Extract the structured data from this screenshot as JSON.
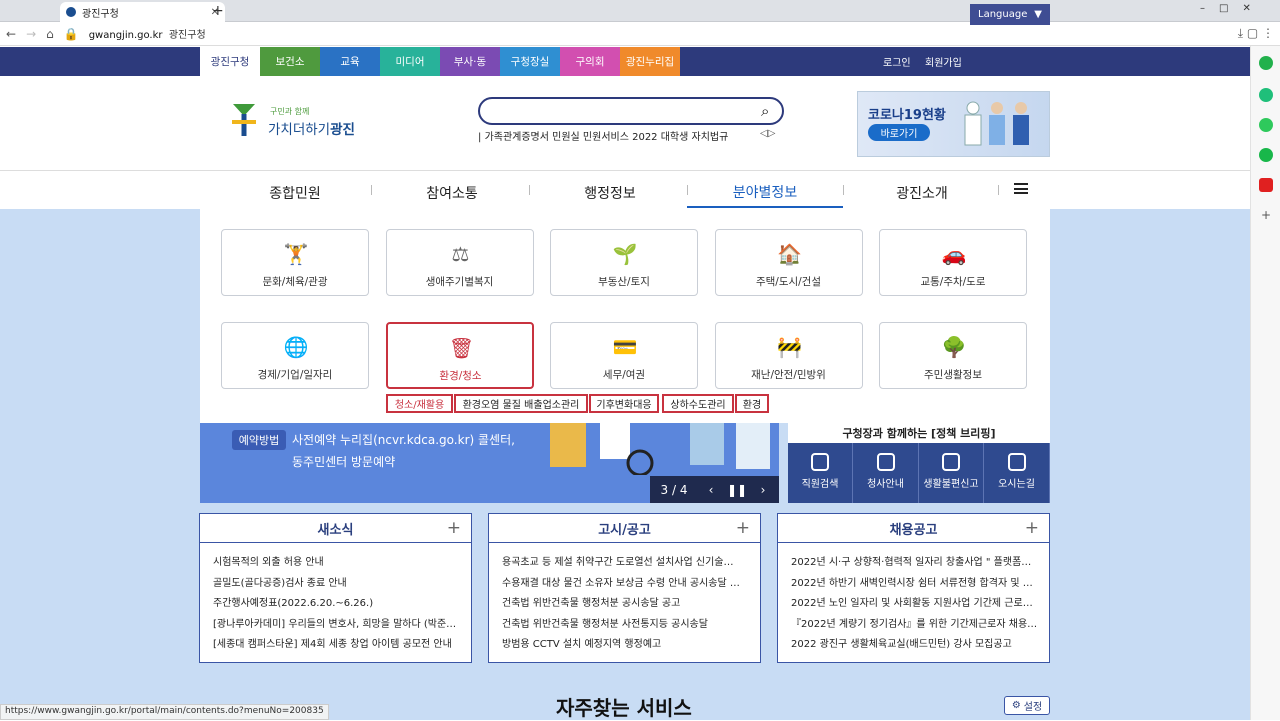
{
  "browser": {
    "tab_title": "광진구청",
    "url_domain": "gwangjin.go.kr",
    "url_title": "광진구청"
  },
  "topbar": {
    "nav": [
      {
        "label": "광진구청",
        "color": "#ffffff",
        "text": "#2d3a7c"
      },
      {
        "label": "보건소",
        "color": "#4f9a3e"
      },
      {
        "label": "교육",
        "color": "#2a72c4"
      },
      {
        "label": "미디어",
        "color": "#28b29a"
      },
      {
        "label": "부사·동",
        "color": "#7b4bb3"
      },
      {
        "label": "구청장실",
        "color": "#2f8fd2"
      },
      {
        "label": "구의회",
        "color": "#d24fb0"
      },
      {
        "label": "광진누리집",
        "color": "#f08a2b"
      }
    ],
    "login": "로그인",
    "signup": "회원가입",
    "language": "Language"
  },
  "header": {
    "logo_small": "구민과 함께",
    "logo_text": "가치더하기",
    "logo_bold": "광진",
    "keywords": "가족관계증명서  민원실  민원서비스  2022  대학생  자치법규",
    "keyword_lead": "|",
    "covid_title": "코로나19현황",
    "covid_button": "바로가기"
  },
  "gnb": [
    "종합민원",
    "참여소통",
    "행정정보",
    "분야별정보",
    "광진소개"
  ],
  "categories": [
    {
      "label": "문화/체육/관광"
    },
    {
      "label": "생애주기별복지"
    },
    {
      "label": "부동산/토지"
    },
    {
      "label": "주택/도시/건설"
    },
    {
      "label": "교통/주차/도로"
    },
    {
      "label": "경제/기업/일자리"
    },
    {
      "label": "환경/청소"
    },
    {
      "label": "세무/여권"
    },
    {
      "label": "재난/안전/민방위"
    },
    {
      "label": "주민생활정보"
    }
  ],
  "submenu": [
    "청소/재활용",
    "환경오염 물질 배출업소관리",
    "기후변화대응",
    "상하수도관리",
    "환경"
  ],
  "banner": {
    "tag": "예약방법",
    "line1": "사전예약 누리집(ncvr.kdca.go.kr) 콜센터,",
    "line2": "동주민센터 방문예약",
    "page": "3 / 4"
  },
  "briefing": {
    "title": "구청장과 함께하는 [정책 브리핑]",
    "items": [
      "직원검색",
      "청사안내",
      "생활불편신고",
      "오시는길"
    ]
  },
  "boards": [
    {
      "title": "새소식",
      "items": [
        "시험목적의 외출 허용 안내",
        "골밀도(골다공증)검사 종료 안내",
        "주간행사예정표(2022.6.20.~6.26.)",
        "[광나루아카데미] 우리들의 변호사, 희망을 말하다 (박준…",
        "[세종대 캠퍼스타운] 제4회 세종 창업 아이템 공모전 안내"
      ]
    },
    {
      "title": "고시/공고",
      "items": [
        "용곡초교 등 제설 취약구간 도로열선 설치사업 신기술…",
        "수용재결 대상 물건 소유자 보상금 수령 안내 공시송달 …",
        "건축법 위반건축물 행정처분 공시송달 공고",
        "건축법 위반건축물 행정처분 사전통지등 공시송달",
        "방범용 CCTV 설치 예정지역 행정예고"
      ]
    },
    {
      "title": "채용공고",
      "items": [
        "2022년 시·구 상향적·협력적 일자리 창출사업 \" 플랫폼…",
        "2022년 하반기 새벽인력시장 쉼터 서류전형 합격자 및 …",
        "2022년 노인 일자리 및 사회활동 지원사업 기간제 근로…",
        "『2022년 계량기 정기검사』를 위한 기간제근로자 채용 …",
        "2022 광진구 생활체육교실(배드민턴) 강사 모집공고"
      ]
    }
  ],
  "footer": {
    "faq": "자주찾는 서비스",
    "setting": "설정",
    "status_url": "https://www.gwangjin.go.kr/portal/main/contents.do?menuNo=200835"
  }
}
